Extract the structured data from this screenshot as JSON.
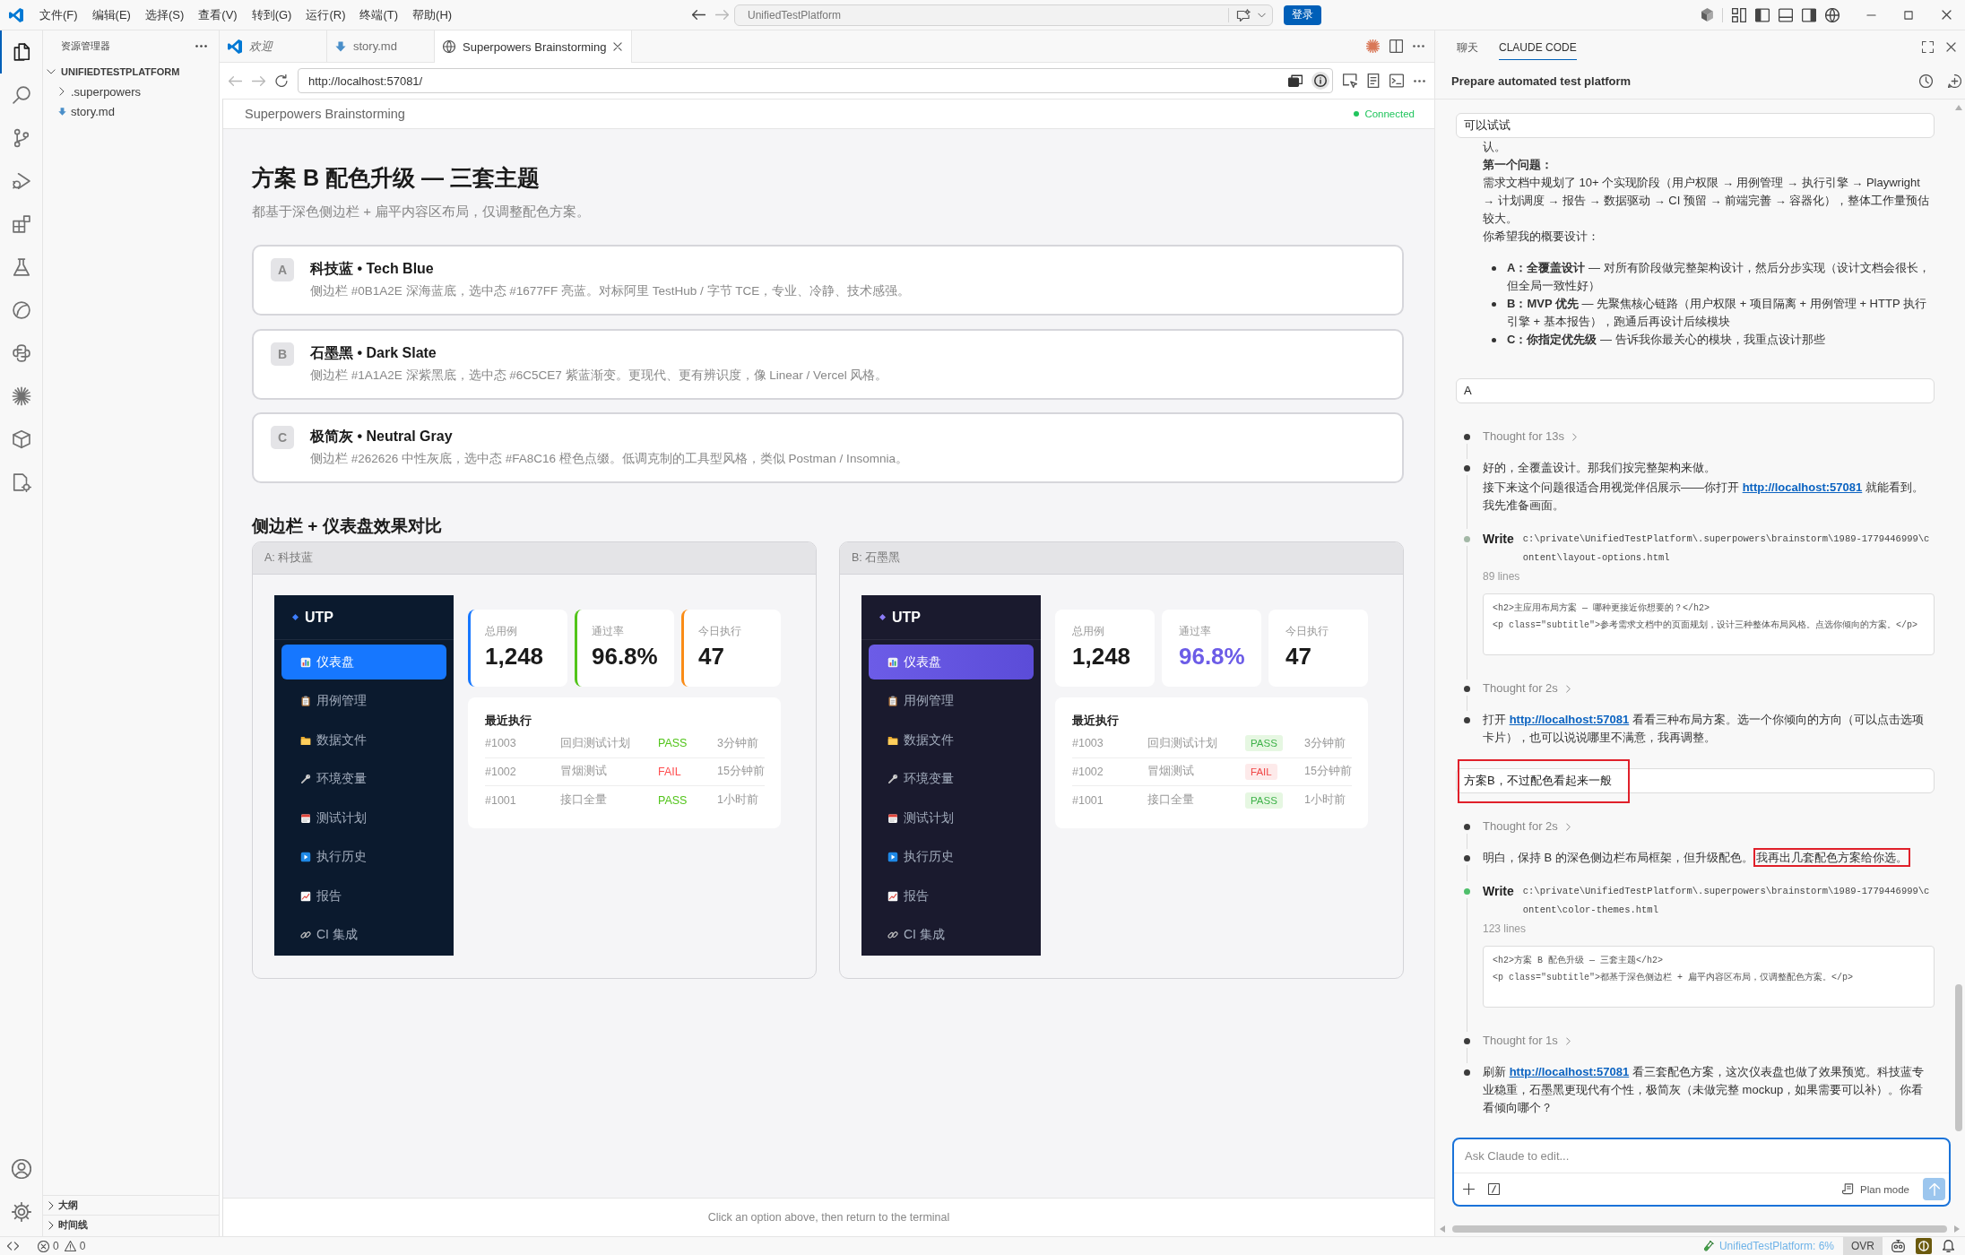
{
  "title_bar": {
    "menu": [
      "文件(F)",
      "编辑(E)",
      "选择(S)",
      "查看(V)",
      "转到(G)",
      "运行(R)",
      "终端(T)",
      "帮助(H)"
    ],
    "command_center": "UnifiedTestPlatform",
    "sign_in": "登录"
  },
  "activity_bar": [
    {
      "selected": true
    },
    {
      "selected": false
    },
    {
      "selected": false
    },
    {
      "selected": false
    },
    {
      "selected": false
    },
    {
      "selected": false
    },
    {
      "selected": false
    },
    {
      "selected": false
    },
    {
      "selected": false
    },
    {
      "selected": false
    },
    {
      "selected": false
    }
  ],
  "explorer": {
    "title": "资源管理器",
    "tree": [
      {
        "label": "UNIFIEDTESTPLATFORM",
        "kind": "root",
        "expanded": true,
        "children": [
          {
            "label": ".superpowers",
            "kind": "folder",
            "expanded": false
          },
          {
            "label": "story.md",
            "kind": "file"
          }
        ]
      }
    ],
    "sections": [
      {
        "label": "大纲",
        "expanded": false
      },
      {
        "label": "时间线",
        "expanded": false
      }
    ]
  },
  "editor_tabs": [
    {
      "label": "欢迎",
      "kind": "welcome",
      "preview": true,
      "selected": false
    },
    {
      "label": "story.md",
      "kind": "markdown",
      "preview": false,
      "selected": false
    },
    {
      "label": "Superpowers Brainstorming",
      "kind": "browser",
      "preview": false,
      "selected": true
    }
  ],
  "browser": {
    "url": "http://localhost:57081/"
  },
  "page": {
    "header": {
      "title": "Superpowers Brainstorming",
      "status": "Connected",
      "connected": true
    },
    "title": "方案 B 配色升级 — 三套主题",
    "subtitle": "都基于深色侧边栏 + 扁平内容区布局，仅调整配色方案。",
    "options": [
      {
        "letter": "A",
        "title": "科技蓝 • Tech Blue",
        "description": "侧边栏 #0B1A2E 深海蓝底，选中态 #1677FF 亮蓝。对标阿里 TestHub / 字节 TCE，专业、冷静、技术感强。",
        "selected": false
      },
      {
        "letter": "B",
        "title": "石墨黑 • Dark Slate",
        "description": "侧边栏 #1A1A2E 深紫黑底，选中态 #6C5CE7 紫蓝渐变。更现代、更有辨识度，像 Linear / Vercel 风格。",
        "selected": false
      },
      {
        "letter": "C",
        "title": "极简灰 • Neutral Gray",
        "description": "侧边栏 #262626 中性灰底，选中态 #FA8C16 橙色点缀。低调克制的工具型风格，类似 Postman / Insomnia。",
        "selected": false
      }
    ],
    "comparison_title": "侧边栏 + 仪表盘效果对比",
    "previews": [
      {
        "label": "A: 科技蓝",
        "kind": "techblue",
        "brand": "UTP",
        "nav": [
          {
            "label": "仪表盘",
            "selected": true
          },
          {
            "label": "用例管理",
            "selected": false
          },
          {
            "label": "数据文件",
            "selected": false
          },
          {
            "label": "环境变量",
            "selected": false
          },
          {
            "label": "测试计划",
            "selected": false
          },
          {
            "label": "执行历史",
            "selected": false
          },
          {
            "label": "报告",
            "selected": false
          },
          {
            "label": "CI 集成",
            "selected": false
          }
        ],
        "stats": [
          {
            "label": "总用例",
            "value": "1,248",
            "color": "#1677ff"
          },
          {
            "label": "通过率",
            "value": "96.8%",
            "color": "#52c41a"
          },
          {
            "label": "今日执行",
            "value": "47",
            "color": "#fa8c16"
          }
        ],
        "recent": {
          "title": "最近执行",
          "rows": [
            {
              "id": "#1003",
              "name": "回归测试计划",
              "status": "PASS",
              "kind": "pass",
              "time": "3分钟前"
            },
            {
              "id": "#1002",
              "name": "冒烟测试",
              "status": "FAIL",
              "kind": "fail",
              "time": "15分钟前"
            },
            {
              "id": "#1001",
              "name": "接口全量",
              "status": "PASS",
              "kind": "pass",
              "time": "1小时前"
            }
          ]
        }
      },
      {
        "label": "B: 石墨黑",
        "kind": "graphite",
        "brand": "UTP",
        "nav": [
          {
            "label": "仪表盘",
            "selected": true
          },
          {
            "label": "用例管理",
            "selected": false
          },
          {
            "label": "数据文件",
            "selected": false
          },
          {
            "label": "环境变量",
            "selected": false
          },
          {
            "label": "测试计划",
            "selected": false
          },
          {
            "label": "执行历史",
            "selected": false
          },
          {
            "label": "报告",
            "selected": false
          },
          {
            "label": "CI 集成",
            "selected": false
          }
        ],
        "stats": [
          {
            "label": "总用例",
            "value": "1,248"
          },
          {
            "label": "通过率",
            "value": "96.8%",
            "color": "#6c5ce7"
          },
          {
            "label": "今日执行",
            "value": "47"
          }
        ],
        "recent": {
          "title": "最近执行",
          "rows": [
            {
              "id": "#1003",
              "name": "回归测试计划",
              "status": "PASS",
              "kind": "pass",
              "time": "3分钟前"
            },
            {
              "id": "#1002",
              "name": "冒烟测试",
              "status": "FAIL",
              "kind": "fail",
              "time": "15分钟前"
            },
            {
              "id": "#1001",
              "name": "接口全量",
              "status": "PASS",
              "kind": "pass",
              "time": "1小时前"
            }
          ]
        }
      }
    ],
    "footer": "Click an option above, then return to the terminal"
  },
  "chat": {
    "tabs": [
      {
        "label": "聊天",
        "selected": false
      },
      {
        "label": "CLAUDE CODE",
        "selected": true
      }
    ],
    "title": "Prepare automated test platform",
    "messages": [
      {
        "kind": "user",
        "text": "可以试试",
        "annotated": false
      },
      {
        "kind": "reply",
        "blocks": [
          {
            "kind": "para",
            "text": "认。"
          },
          {
            "kind": "heading",
            "text": "第一个问题："
          },
          {
            "kind": "para",
            "text": "需求文档中规划了 10+ 个实现阶段（用户权限 → 用例管理 → 执行引擎 → Playwright → 计划调度 → 报告 → 数据驱动 → CI 预留 → 前端完善 → 容器化），整体工作量预估较大。"
          },
          {
            "kind": "para",
            "text": "你希望我的概要设计："
          },
          {
            "kind": "bullets",
            "items": [
              "**A：全覆盖设计** — 对所有阶段做完整架构设计，然后分步实现（设计文档会很长，但全局一致性好）",
              "**B：MVP 优先** — 先聚焦核心链路（用户权限 + 项目隔离 + 用例管理 + HTTP 执行引擎 + 基本报告），跑通后再设计后续模块",
              "**C：你指定优先级** — 告诉我你最关心的模块，我重点设计那些"
            ]
          }
        ]
      },
      {
        "kind": "user",
        "text": "A",
        "annotated": false
      },
      {
        "kind": "steps",
        "items": [
          {
            "kind": "thought",
            "text": "Thought for 13s",
            "color": "#3c3c3c"
          },
          {
            "kind": "text",
            "color": "#3c3c3c",
            "paragraphs": [
              {
                "segments": [
                  {
                    "kind": "text",
                    "text": "好的，全覆盖设计。那我们按完整架构来做。"
                  }
                ]
              },
              {
                "segments": [
                  {
                    "kind": "text",
                    "text": "接下来这个问题很适合用视觉伴侣展示——你打开 "
                  },
                  {
                    "kind": "link",
                    "text": "http://localhost:57081"
                  },
                  {
                    "kind": "text",
                    "text": " 就能看到。我先准备画面。"
                  }
                ]
              }
            ]
          },
          {
            "kind": "write",
            "color": "#a3b8a6",
            "label": "Write",
            "path": "c:\\private\\UnifiedTestPlatform\\.superpowers\\brainstorm\\1989-1779446999\\content\\layout-options.html",
            "lines": "89 lines",
            "code": [
              "<h2>主应用布局方案 — 哪种更接近你想要的？</h2>",
              "<p class=\"subtitle\">参考需求文档中的页面规划，设计三种整体布局风格。点选你倾向的方案。</p>"
            ]
          },
          {
            "kind": "thought",
            "text": "Thought for 2s",
            "color": "#3c3c3c"
          },
          {
            "kind": "text",
            "color": "#3c3c3c",
            "paragraphs": [
              {
                "segments": [
                  {
                    "kind": "text",
                    "text": "打开 "
                  },
                  {
                    "kind": "link",
                    "text": "http://localhost:57081"
                  },
                  {
                    "kind": "text",
                    "text": " 看看三种布局方案。选一个你倾向的方向（可以点击选项卡片），也可以说说哪里不满意，我再调整。"
                  }
                ]
              }
            ]
          }
        ]
      },
      {
        "kind": "user",
        "text": "方案B，不过配色看起来一般",
        "annotated": true
      },
      {
        "kind": "steps",
        "items": [
          {
            "kind": "thought",
            "text": "Thought for 2s",
            "color": "#3c3c3c"
          },
          {
            "kind": "text",
            "color": "#3c3c3c",
            "paragraphs": [
              {
                "segments": [
                  {
                    "kind": "text",
                    "text": "明白，保持 B 的深色侧边栏布局框架，但升级配色。"
                  },
                  {
                    "kind": "mark",
                    "text": "我再出几套配色方案给你选。"
                  }
                ]
              }
            ]
          },
          {
            "kind": "write",
            "color": "#4fbf6b",
            "label": "Write",
            "path": "c:\\private\\UnifiedTestPlatform\\.superpowers\\brainstorm\\1989-1779446999\\content\\color-themes.html",
            "lines": "123 lines",
            "code": [
              "<h2>方案 B 配色升级 — 三套主题</h2>",
              "<p class=\"subtitle\">都基于深色侧边栏 + 扁平内容区布局，仅调整配色方案。</p>"
            ]
          },
          {
            "kind": "thought",
            "text": "Thought for 1s",
            "color": "#3c3c3c"
          },
          {
            "kind": "text",
            "color": "#3c3c3c",
            "paragraphs": [
              {
                "segments": [
                  {
                    "kind": "text",
                    "text": "刷新 "
                  },
                  {
                    "kind": "link",
                    "text": "http://localhost:57081"
                  },
                  {
                    "kind": "text",
                    "text": " 看三套配色方案，这次仪表盘也做了效果预览。科技蓝专业稳重，石墨黑更现代有个性，极简灰（未做完整 mockup，如果需要可以补）。你看看倾向哪个？"
                  }
                ]
              }
            ]
          }
        ]
      }
    ],
    "composer": {
      "placeholder": "Ask Claude to edit...",
      "plan_mode": "Plan mode",
      "send_disabled": true
    }
  },
  "status_bar": {
    "problems": {
      "errors": "0",
      "warnings": "0"
    },
    "project": "UnifiedTestPlatform: 6%",
    "mode": "OVR"
  }
}
